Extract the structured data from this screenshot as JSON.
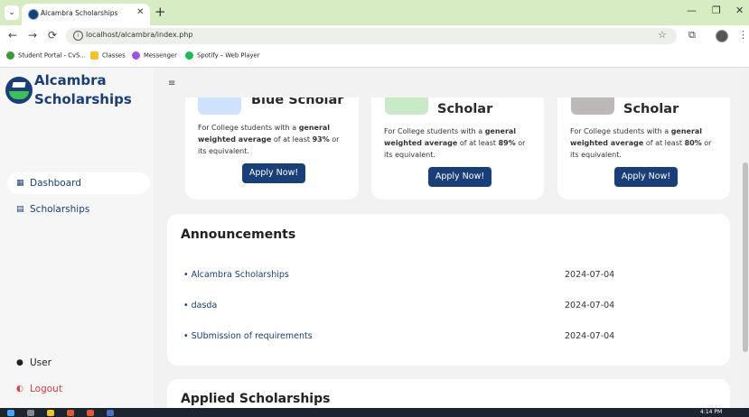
{
  "browser": {
    "tab_title": "Alcambra Scholarships",
    "tab_close": "✕",
    "tab_menu": "⌄",
    "new_tab": "+",
    "url": "localhost/alcambra/index.php",
    "nav_back": "←",
    "nav_forward": "→",
    "nav_reload": "⟳",
    "star": "☆",
    "window_min": "—",
    "window_restore": "❐",
    "window_close": "✕",
    "bookmarks": [
      "Student Portal - CvS...",
      "Classes",
      "Messenger",
      "Spotify – Web Player"
    ]
  },
  "sidebar": {
    "brand_line1": "Alcambra",
    "brand_line2": "Scholarships",
    "hamburger": "≡",
    "items": [
      {
        "label": "Dashboard",
        "icon": "▦",
        "active": true
      },
      {
        "label": "Scholarships",
        "icon": "▤",
        "active": false
      }
    ],
    "user": {
      "label": "User",
      "icon": "●"
    },
    "logout": {
      "label": "Logout",
      "icon": "◐"
    }
  },
  "scholarships": [
    {
      "title": "Blue Scholar",
      "desc_pre": "For College students with a ",
      "desc_bold": "general weighted average",
      "desc_mid": " of at least ",
      "desc_pct": "93%",
      "desc_post": " or its equivalent.",
      "button": "Apply Now!",
      "icon_color": "#cfe2ff"
    },
    {
      "title": "Scholar",
      "desc_pre": "For College students with a ",
      "desc_bold": "general weighted average",
      "desc_mid": " of at least ",
      "desc_pct": "89%",
      "desc_post": " or its equivalent.",
      "button": "Apply Now!",
      "icon_color": "#c9eac7"
    },
    {
      "title": "Scholar",
      "desc_pre": "For College students with a ",
      "desc_bold": "general weighted average",
      "desc_mid": " of at least ",
      "desc_pct": "80%",
      "desc_post": " or its equivalent.",
      "button": "Apply Now!",
      "icon_color": "#bdb8b8"
    }
  ],
  "announcements": {
    "title": "Announcements",
    "items": [
      {
        "title": "• Alcambra Scholarships",
        "date": "2024-07-04"
      },
      {
        "title": "• dasda",
        "date": "2024-07-04"
      },
      {
        "title": "• SUbmission of requirements",
        "date": "2024-07-04"
      }
    ]
  },
  "applied": {
    "title": "Applied Scholarships"
  },
  "taskbar": {
    "clock": "4:14 PM"
  },
  "colors": {
    "brand": "#1a3f78",
    "tab_bar": "#d8ecc4",
    "logout": "#d64040"
  }
}
